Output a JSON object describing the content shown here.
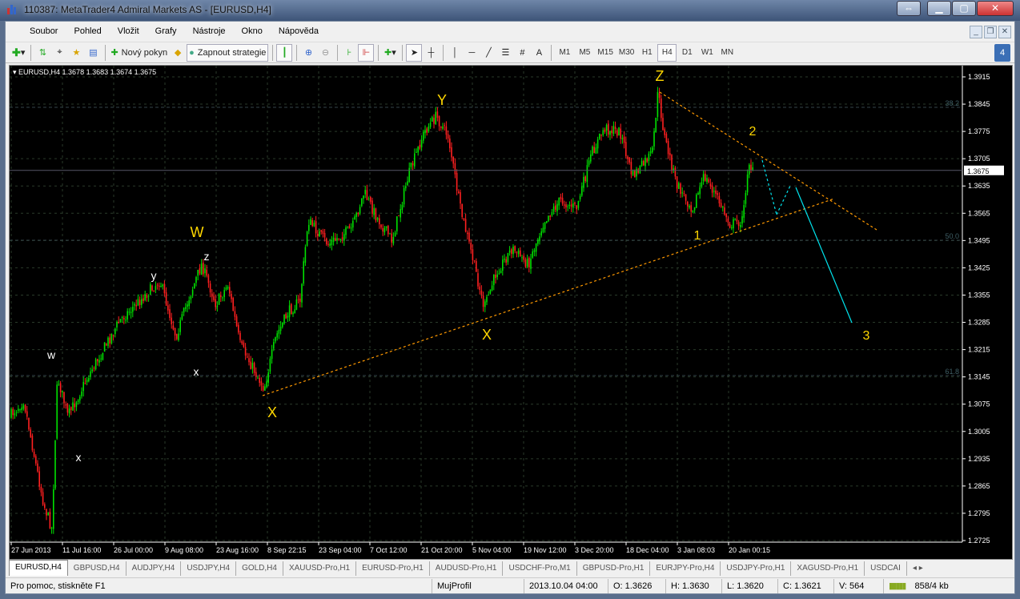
{
  "window": {
    "title": "110387: MetaTrader4 Admiral Markets AS - [EURUSD,H4]"
  },
  "menu": [
    "Soubor",
    "Pohled",
    "Vložit",
    "Grafy",
    "Nástroje",
    "Okno",
    "Nápověda"
  ],
  "toolbar": {
    "new_order": "Nový pokyn",
    "strategy": "Zapnout strategie",
    "text_tool": "A",
    "timeframes": [
      "M1",
      "M5",
      "M15",
      "M30",
      "H1",
      "H4",
      "D1",
      "W1",
      "MN"
    ],
    "active_timeframe": "H4",
    "alerts_count": "4"
  },
  "chart": {
    "header": "EURUSD,H4  1.3678 1.3683 1.3674 1.3675",
    "current_price": "1.3675"
  },
  "chart_data": {
    "type": "candlestick",
    "symbol": "EURUSD",
    "timeframe": "H4",
    "ohlc_last": {
      "open": 1.3678,
      "high": 1.3683,
      "low": 1.3674,
      "close": 1.3675
    },
    "price_ticks": [
      "1.3915",
      "1.3845",
      "1.3775",
      "1.3705",
      "1.3635",
      "1.3565",
      "1.3495",
      "1.3425",
      "1.3355",
      "1.3285",
      "1.3215",
      "1.3145",
      "1.3075",
      "1.3005",
      "1.2935",
      "1.2865",
      "1.2795",
      "1.2725"
    ],
    "ylim": [
      1.2725,
      1.3915
    ],
    "time_ticks": [
      "27 Jun 2013",
      "11 Jul 16:00",
      "26 Jul 00:00",
      "9 Aug 08:00",
      "23 Aug 16:00",
      "8 Sep 22:15",
      "23 Sep 04:00",
      "7 Oct 12:00",
      "21 Oct 20:00",
      "5 Nov 04:00",
      "19 Nov 12:00",
      "3 Dec 20:00",
      "18 Dec 04:00",
      "3 Jan 08:03",
      "20 Jan 00:15"
    ],
    "fib_levels": [
      "38.2",
      "50.0",
      "61.8"
    ],
    "wave_labels": [
      {
        "text": "w",
        "color": "#ffffff"
      },
      {
        "text": "x",
        "color": "#ffffff"
      },
      {
        "text": "y",
        "color": "#ffffff"
      },
      {
        "text": "x",
        "color": "#ffffff"
      },
      {
        "text": "z",
        "color": "#ffffff"
      },
      {
        "text": "W",
        "color": "#ffd700"
      },
      {
        "text": "X",
        "color": "#ffd700"
      },
      {
        "text": "Y",
        "color": "#ffd700"
      },
      {
        "text": "X",
        "color": "#ffd700"
      },
      {
        "text": "Z",
        "color": "#ffd700"
      },
      {
        "text": "1",
        "color": "#ffd700"
      },
      {
        "text": "2",
        "color": "#ffd700"
      },
      {
        "text": "3",
        "color": "#ffd700"
      }
    ],
    "colors": {
      "bull": "#00e000",
      "bear": "#ff2020",
      "trendline": "#ff9900",
      "projection": "#00e5ee",
      "grid": "#2a3a2a"
    }
  },
  "tabs": [
    "EURUSD,H4",
    "GBPUSD,H4",
    "AUDJPY,H4",
    "USDJPY,H4",
    "GOLD,H4",
    "XAUUSD-Pro,H1",
    "EURUSD-Pro,H1",
    "AUDUSD-Pro,H1",
    "USDCHF-Pro,M1",
    "GBPUSD-Pro,H1",
    "EURJPY-Pro,H4",
    "USDJPY-Pro,H1",
    "XAGUSD-Pro,H1",
    "USDCAI"
  ],
  "status": {
    "help": "Pro pomoc, stiskněte F1",
    "profile": "MujProfil",
    "datetime": "2013.10.04 04:00",
    "open": "O: 1.3626",
    "high": "H: 1.3630",
    "low": "L: 1.3620",
    "close": "C: 1.3621",
    "volume": "V: 564",
    "traffic": "858/4 kb"
  }
}
